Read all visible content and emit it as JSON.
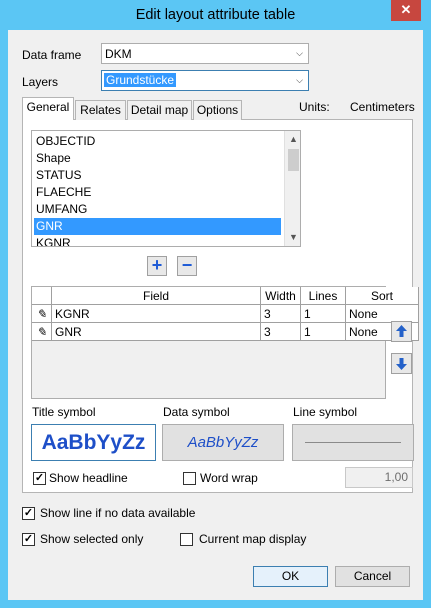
{
  "window": {
    "title": "Edit layout attribute table",
    "close_glyph": "✕"
  },
  "data_frame": {
    "label": "Data frame",
    "value": "DKM"
  },
  "layers": {
    "label": "Layers",
    "value": "Grundstücke"
  },
  "tabs": [
    {
      "label": "General"
    },
    {
      "label": "Relates"
    },
    {
      "label": "Detail map"
    },
    {
      "label": "Options"
    }
  ],
  "units": {
    "label": "Units:",
    "value": "Centimeters"
  },
  "field_list": {
    "items": [
      "OBJECTID",
      "Shape",
      "STATUS",
      "FLAECHE",
      "UMFANG",
      "GNR",
      "KGNR"
    ],
    "selected": "GNR"
  },
  "buttons": {
    "add": "+",
    "remove": "−",
    "ok": "OK",
    "cancel": "Cancel"
  },
  "table": {
    "headers": [
      "Field",
      "Width",
      "Lines",
      "Sort"
    ],
    "rows": [
      {
        "field": "KGNR",
        "width": "3",
        "lines": "1",
        "sort": "None"
      },
      {
        "field": "GNR",
        "width": "3",
        "lines": "1",
        "sort": "None"
      }
    ]
  },
  "symbols": {
    "title_label": "Title symbol",
    "data_label": "Data symbol",
    "line_label": "Line symbol",
    "title_sample": "AaBbYyZz",
    "data_sample": "AaBbYyZz"
  },
  "show_headline": {
    "label": "Show headline",
    "checked": true
  },
  "word_wrap": {
    "label": "Word wrap",
    "checked": false
  },
  "wrap_value": "1,00",
  "show_line_no_data": {
    "label": "Show line if no data available",
    "checked": true
  },
  "show_selected_only": {
    "label": "Show selected only",
    "checked": true
  },
  "current_map_display": {
    "label": "Current map display",
    "checked": false
  },
  "colors": {
    "accent": "#3399ff",
    "title_bar": "#5bc6f4",
    "close": "#c7473f",
    "symbol_text": "#1e4fc8"
  }
}
